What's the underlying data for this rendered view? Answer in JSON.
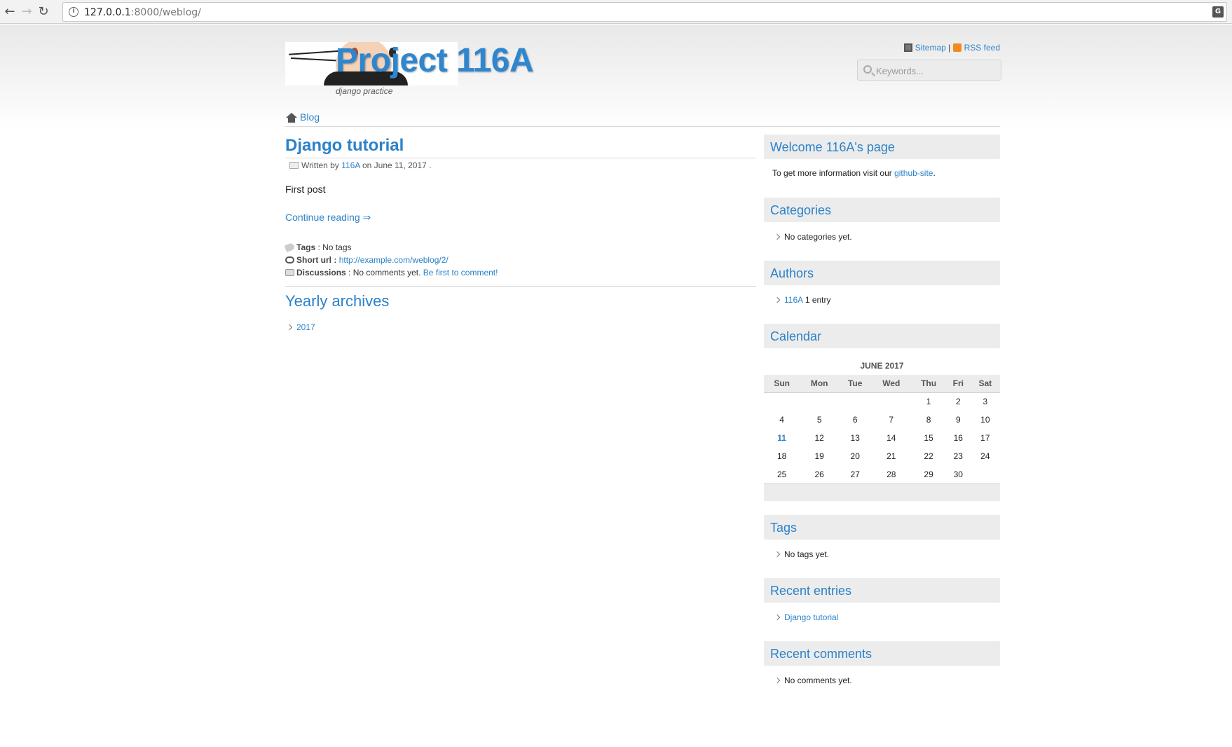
{
  "browser": {
    "url_host": "127.0.0.1",
    "url_rest": ":8000/weblog/"
  },
  "header": {
    "title": "Project 116A",
    "tagline": "django practice",
    "sitemap_label": "Sitemap",
    "separator": "|",
    "rss_label": "RSS feed",
    "search_placeholder": "Keywords..."
  },
  "breadcrumb": {
    "home_label": "Blog"
  },
  "post": {
    "title": "Django tutorial",
    "written_by": "Written by",
    "author": "116A",
    "date_text": "on June 11, 2017 .",
    "body": "First post",
    "continue_label": "Continue reading ⇒",
    "tags_label": "Tags",
    "tags_value": ": No tags",
    "short_url_label": "Short url",
    "short_url_sep": ":",
    "short_url": "http://example.com/weblog/2/",
    "discussions_label": "Discussions",
    "discussions_value": ": No comments yet.",
    "comment_link": "Be first to comment!"
  },
  "archives": {
    "title": "Yearly archives",
    "years": [
      "2017"
    ]
  },
  "sidebar": {
    "welcome": {
      "title": "Welcome 116A's page",
      "text": "To get more information visit our",
      "link": "github-site",
      "end": "."
    },
    "categories": {
      "title": "Categories",
      "empty": "No categories yet."
    },
    "authors": {
      "title": "Authors",
      "name": "116A",
      "count": "1 entry"
    },
    "calendar": {
      "title": "Calendar",
      "caption": "JUNE 2017",
      "days": [
        "Sun",
        "Mon",
        "Tue",
        "Wed",
        "Thu",
        "Fri",
        "Sat"
      ],
      "weeks": [
        [
          "",
          "",
          "",
          "",
          "1",
          "2",
          "3"
        ],
        [
          "4",
          "5",
          "6",
          "7",
          "8",
          "9",
          "10"
        ],
        [
          "11",
          "12",
          "13",
          "14",
          "15",
          "16",
          "17"
        ],
        [
          "18",
          "19",
          "20",
          "21",
          "22",
          "23",
          "24"
        ],
        [
          "25",
          "26",
          "27",
          "28",
          "29",
          "30",
          ""
        ]
      ],
      "highlighted_day": "11"
    },
    "tags": {
      "title": "Tags",
      "empty": "No tags yet."
    },
    "recent_entries": {
      "title": "Recent entries",
      "item": "Django tutorial"
    },
    "recent_comments": {
      "title": "Recent comments",
      "empty": "No comments yet."
    }
  },
  "colors": {
    "link": "#2b82c9",
    "title": "#2e86cf",
    "widget_bg": "#ececec"
  }
}
